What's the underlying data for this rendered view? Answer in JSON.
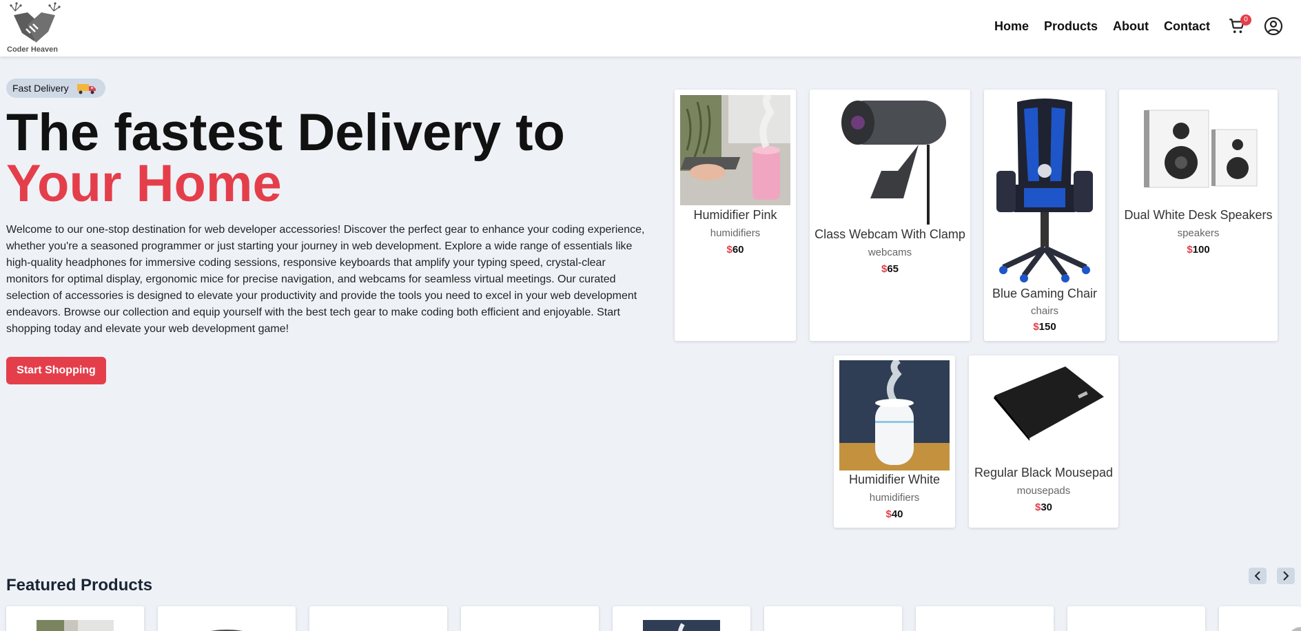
{
  "header": {
    "logo_text": "Coder Heaven",
    "nav": [
      "Home",
      "Products",
      "About",
      "Contact"
    ],
    "cart_count": "0"
  },
  "hero": {
    "badge": "Fast Delivery",
    "title_line1": "The fastest Delivery to",
    "title_line2": "Your Home",
    "description": "Welcome to our one-stop destination for web developer accessories! Discover the perfect gear to enhance your coding experience, whether you're a seasoned programmer or just starting your journey in web development. Explore a wide range of essentials like high-quality headphones for immersive coding sessions, responsive keyboards that amplify your typing speed, crystal-clear monitors for optimal display, ergonomic mice for precise navigation, and webcams for seamless virtual meetings. Our curated selection of accessories is designed to elevate your productivity and provide the tools you need to excel in your web development endeavors. Browse our collection and equip yourself with the best tech gear to make coding both efficient and enjoyable. Start shopping today and elevate your web development game!",
    "cta": "Start Shopping"
  },
  "products": [
    {
      "name": "Humidifier Pink",
      "category": "humidifiers",
      "currency": "$",
      "price": "60"
    },
    {
      "name": "Class Webcam With Clamp",
      "category": "webcams",
      "currency": "$",
      "price": "65"
    },
    {
      "name": "Blue Gaming Chair",
      "category": "chairs",
      "currency": "$",
      "price": "150"
    },
    {
      "name": "Dual White Desk Speakers",
      "category": "speakers",
      "currency": "$",
      "price": "100"
    },
    {
      "name": "Humidifier White",
      "category": "humidifiers",
      "currency": "$",
      "price": "40"
    },
    {
      "name": "Regular Black Mousepad",
      "category": "mousepads",
      "currency": "$",
      "price": "30"
    }
  ],
  "featured": {
    "title": "Featured Products"
  },
  "colors": {
    "accent": "#e53e4b",
    "background": "#eef2f7",
    "badge_bg": "#cfd9e6"
  },
  "icons": [
    "logo-handshake-icon",
    "cart-icon",
    "user-icon",
    "truck-icon",
    "chevron-left-icon",
    "chevron-right-icon"
  ]
}
